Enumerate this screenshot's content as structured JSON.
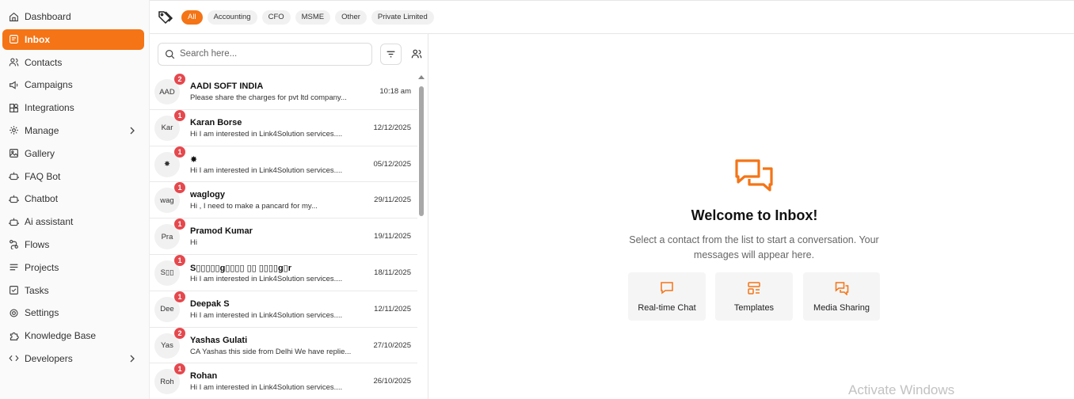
{
  "sidebar": {
    "items": [
      {
        "label": "Dashboard",
        "icon": "home-icon"
      },
      {
        "label": "Inbox",
        "icon": "inbox-icon",
        "active": true
      },
      {
        "label": "Contacts",
        "icon": "contacts-icon"
      },
      {
        "label": "Campaigns",
        "icon": "megaphone-icon"
      },
      {
        "label": "Integrations",
        "icon": "integrations-icon"
      },
      {
        "label": "Manage",
        "icon": "gear-icon",
        "has_submenu": true
      },
      {
        "label": "Gallery",
        "icon": "gallery-icon"
      },
      {
        "label": "FAQ Bot",
        "icon": "bot-icon"
      },
      {
        "label": "Chatbot",
        "icon": "bot-icon"
      },
      {
        "label": "Ai assistant",
        "icon": "bot-icon"
      },
      {
        "label": "Flows",
        "icon": "flows-icon"
      },
      {
        "label": "Projects",
        "icon": "projects-icon"
      },
      {
        "label": "Tasks",
        "icon": "tasks-icon"
      },
      {
        "label": "Settings",
        "icon": "gear-icon"
      },
      {
        "label": "Knowledge Base",
        "icon": "puzzle-icon"
      },
      {
        "label": "Developers",
        "icon": "code-icon",
        "has_submenu": true
      }
    ]
  },
  "filters": {
    "chips": [
      "All",
      "Accounting",
      "CFO",
      "MSME",
      "Other",
      "Private Limited"
    ],
    "active": "All"
  },
  "search": {
    "placeholder": "Search here...",
    "value": ""
  },
  "conversations": [
    {
      "avatar": "AAD",
      "badge": "2",
      "name": "AADI SOFT INDIA",
      "message": "Please share the charges for pvt ltd company...",
      "time": "10:18 am"
    },
    {
      "avatar": "Kar",
      "badge": "1",
      "name": "Karan Borse",
      "message": "Hi I am interested in Link4Solution services....",
      "time": "12/12/2025"
    },
    {
      "avatar": "✸",
      "badge": "1",
      "name": "✸",
      "message": "Hi I am interested in Link4Solution services....",
      "time": "05/12/2025"
    },
    {
      "avatar": "wag",
      "badge": "1",
      "name": "waglogy",
      "message": "Hi , I need to make a pancard for my...",
      "time": "29/11/2025"
    },
    {
      "avatar": "Pra",
      "badge": "1",
      "name": "Pramod Kumar",
      "message": "Hi",
      "time": "19/11/2025"
    },
    {
      "avatar": "S▯▯",
      "badge": "1",
      "name": "S▯▯▯▯▯g▯▯▯▯ ▯▯ ▯▯▯▯g▯r",
      "message": "Hi I am interested in Link4Solution services....",
      "time": "18/11/2025"
    },
    {
      "avatar": "Dee",
      "badge": "1",
      "name": "Deepak S",
      "message": "Hi I am interested in Link4Solution services....",
      "time": "12/11/2025"
    },
    {
      "avatar": "Yas",
      "badge": "2",
      "name": "Yashas Gulati",
      "message": "CA Yashas this side from Delhi We have replie...",
      "time": "27/10/2025"
    },
    {
      "avatar": "Roh",
      "badge": "1",
      "name": "Rohan",
      "message": "Hi I am interested in Link4Solution services....",
      "time": "26/10/2025"
    }
  ],
  "welcome": {
    "title": "Welcome to Inbox!",
    "subtitle": "Select a contact from the list to start a conversation. Your messages will appear here.",
    "features": [
      {
        "label": "Real-time Chat",
        "icon": "chat-icon"
      },
      {
        "label": "Templates",
        "icon": "templates-icon"
      },
      {
        "label": "Media Sharing",
        "icon": "media-sharing-icon"
      }
    ]
  },
  "watermark": "Activate Windows",
  "colors": {
    "accent": "#f47416",
    "badge": "#e5484d"
  }
}
